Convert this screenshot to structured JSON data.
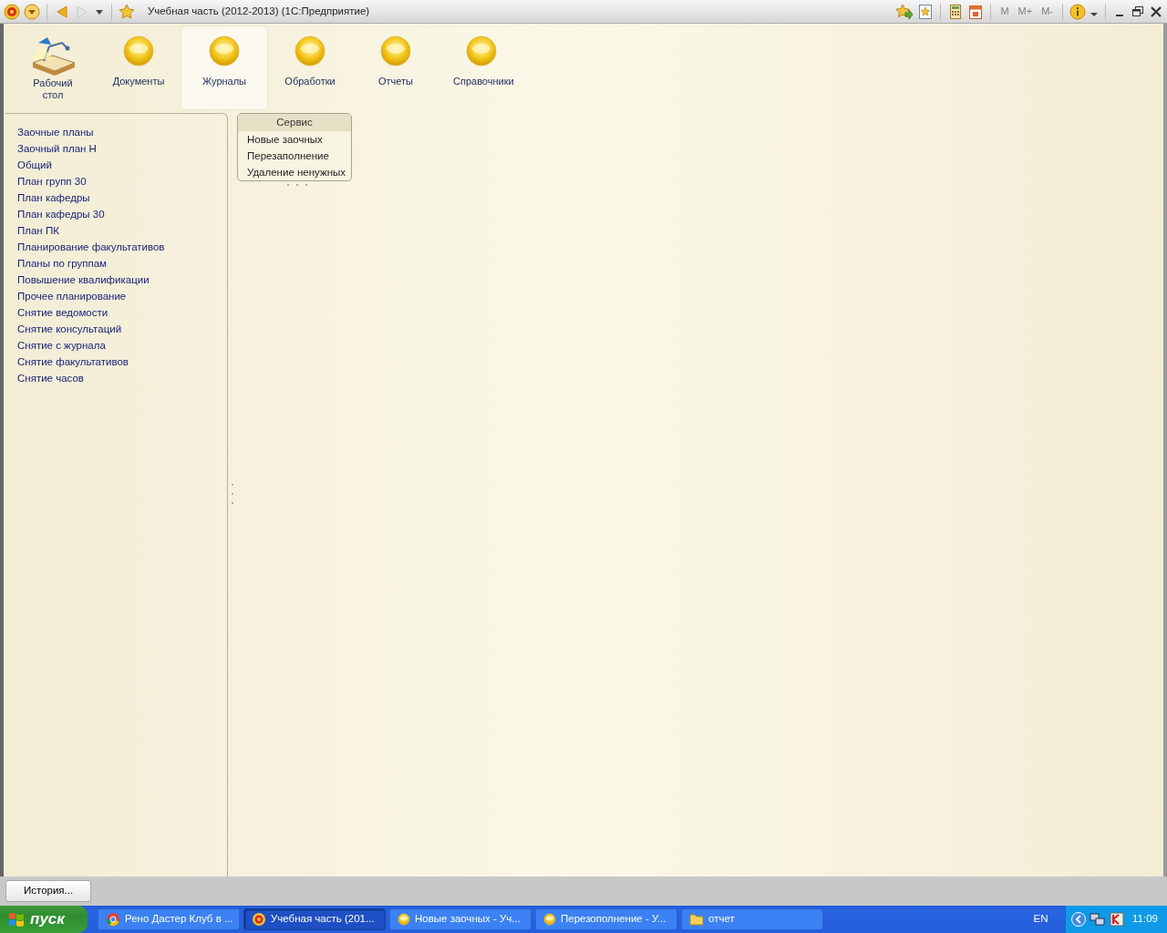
{
  "window": {
    "title": "Учебная часть (2012-2013)  (1С:Предприятие)"
  },
  "memory_buttons": [
    {
      "label": "M",
      "disabled": true
    },
    {
      "label": "M+",
      "disabled": true
    },
    {
      "label": "M-",
      "disabled": true
    }
  ],
  "sections": [
    {
      "label": "Рабочий стол",
      "kind": "desk",
      "selected": false
    },
    {
      "label": "Документы",
      "kind": "ball",
      "selected": false
    },
    {
      "label": "Журналы",
      "kind": "ball",
      "selected": true
    },
    {
      "label": "Обработки",
      "kind": "ball",
      "selected": false
    },
    {
      "label": "Отчеты",
      "kind": "ball",
      "selected": false
    },
    {
      "label": "Справочники",
      "kind": "ball",
      "selected": false
    }
  ],
  "nav_items": [
    "Заочные планы",
    "Заочный план Н",
    "Общий",
    "План групп 30",
    "План кафедры",
    "План кафедры 30",
    "План ПК",
    "Планирование факультативов",
    "Планы по группам",
    "Повышение квалификации",
    "Прочее планирование",
    "Снятие ведомости",
    "Снятие консультаций",
    "Снятие с журнала",
    "Снятие факультативов",
    "Снятие часов"
  ],
  "service_group": {
    "title": "Сервис",
    "items": [
      "Новые заочных",
      "Перезаполнение",
      "Удаление ненужных"
    ]
  },
  "history_button": "История...",
  "taskbar": {
    "start": "пуск",
    "tasks": [
      {
        "label": "Рено Дастер Клуб в ...",
        "kind": "browser",
        "selected": false
      },
      {
        "label": "Учебная часть (201...",
        "kind": "app",
        "selected": true
      },
      {
        "label": "Новые заочных - Уч...",
        "kind": "ball",
        "selected": false
      },
      {
        "label": "Перезополнение - У...",
        "kind": "ball",
        "selected": false
      },
      {
        "label": "отчет",
        "kind": "folder",
        "selected": false
      }
    ],
    "language": "EN",
    "clock": "11:09"
  }
}
